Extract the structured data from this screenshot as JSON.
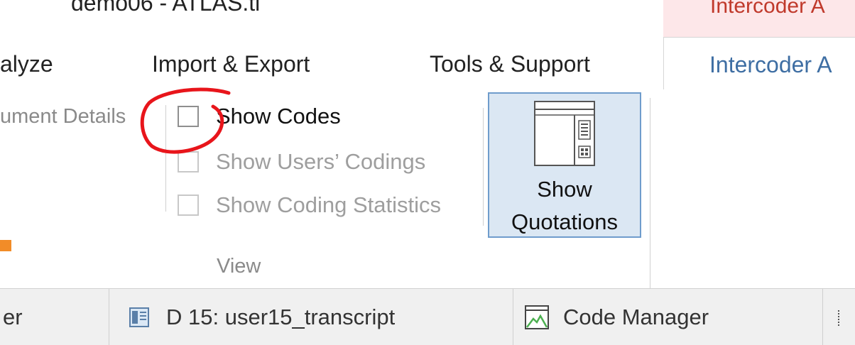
{
  "window": {
    "title": "demo06 - ATLAS.ti",
    "contextual_header": "Intercoder A"
  },
  "tabs": [
    {
      "label": "alyze"
    },
    {
      "label": "Import & Export"
    },
    {
      "label": "Tools & Support"
    },
    {
      "label": "Intercoder A",
      "active": true
    }
  ],
  "ribbon": {
    "document_details": "ument Details",
    "checkboxes": [
      {
        "label": "Show Codes",
        "checked": false,
        "enabled": true
      },
      {
        "label": "Show Users’ Codings",
        "checked": false,
        "enabled": false
      },
      {
        "label": "Show Coding Statistics",
        "checked": false,
        "enabled": false
      }
    ],
    "group_label": "View",
    "show_quotations": {
      "line1": "Show",
      "line2": "Quotations"
    }
  },
  "document_tabs": [
    {
      "label": "er"
    },
    {
      "label": "D 15: user15_transcript",
      "icon": "document-icon"
    },
    {
      "label": "Code Manager",
      "icon": "code-manager-icon"
    }
  ],
  "colors": {
    "accent": "#3e6ea3",
    "annotation": "#e8151b",
    "selected_button": "#dbe7f3",
    "orange_marker": "#f28c28"
  }
}
